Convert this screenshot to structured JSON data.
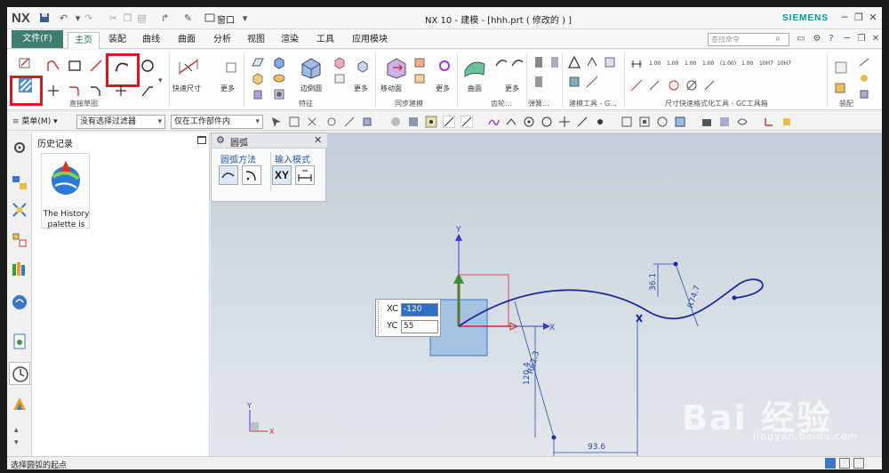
{
  "app": {
    "logo": "NX",
    "window_title": "NX 10 - 建模 - [hhh.prt  ( 修改的 ) ]",
    "brand": "SIEMENS",
    "window_menu_label": "窗口"
  },
  "tabs": {
    "file": "文件(F)",
    "items": [
      "主页",
      "装配",
      "曲线",
      "曲面",
      "分析",
      "视图",
      "渲染",
      "工具",
      "应用模块"
    ],
    "active": "主页",
    "search_placeholder": "查找命令"
  },
  "ribbon": {
    "groups": {
      "direct_sketch": "直接草图",
      "feature": "特征",
      "sync_modeling": "同步建模",
      "gear": "齿轮...",
      "spring": "弹簧...",
      "modeling_tools": "建模工具 - G...",
      "dim_tools": "尺寸快速格式化工具 - GC工具箱",
      "assembly": "装配"
    },
    "buttons": {
      "quick_dim": "快速尺寸",
      "more_1": "更多",
      "edge_blend": "边倒圆",
      "more_2": "更多",
      "move_face": "移动面",
      "more_3": "更多",
      "surface": "曲面",
      "more_4": "更多"
    },
    "dim_format_labels": [
      "1.00",
      "1.00",
      "1.00",
      "1.00",
      "(1.00)",
      "1.00",
      "10H7",
      "10H7"
    ]
  },
  "selection_bar": {
    "menu_label": "菜单(M)",
    "filter": "没有选择过滤器",
    "scope": "仅在工作部件内"
  },
  "history": {
    "title": "历史记录",
    "item_text": "The History palette is"
  },
  "arc_dialog": {
    "title": "圆弧",
    "method_label": "圆弧方法",
    "input_label": "输入模式",
    "xy_label": "XY"
  },
  "coords": {
    "xc_label": "XC",
    "xc_value": "-120",
    "yc_label": "YC",
    "yc_value": "55"
  },
  "sketch": {
    "dim_radius": "R62.3",
    "dim_vertical": "120.4",
    "dim_horizontal": "93.6",
    "dim_small": "36.1",
    "dim_right": "R74.7",
    "axis_x": "X",
    "axis_y": "Y"
  },
  "watermark": {
    "text": "Bai 经验",
    "url": "jingyan.baidu.com"
  },
  "status": {
    "text": "选择圆弧的起点"
  },
  "colors": {
    "file_tab": "#3f7d6e",
    "brand": "#009999",
    "highlight": "#e0141e",
    "curve": "#1a2a9a",
    "input_selected": "#2f6fc7"
  }
}
